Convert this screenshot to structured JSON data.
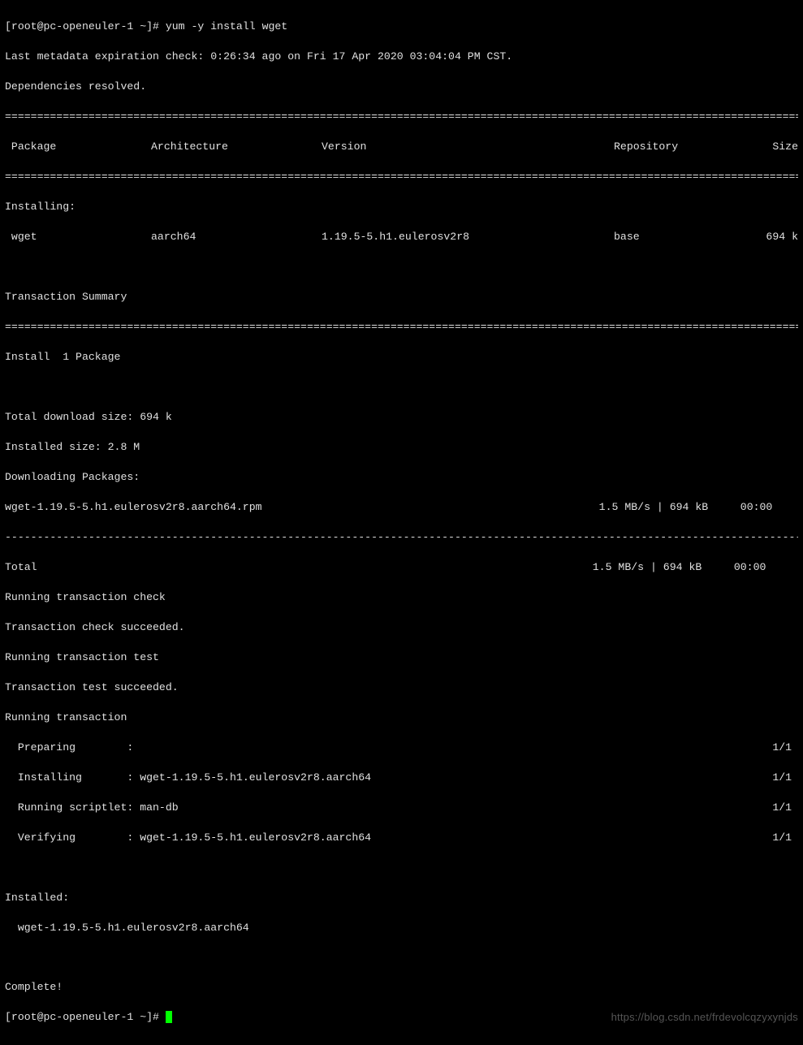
{
  "prompt1": "[root@pc-openeuler-1 ~]# ",
  "command": "yum -y install wget",
  "meta_line": "Last metadata expiration check: 0:26:34 ago on Fri 17 Apr 2020 03:04:04 PM CST.",
  "deps_line": "Dependencies resolved.",
  "hr_eq": "=================================================================================================================================",
  "hr_dash": "---------------------------------------------------------------------------------------------------------------------------------",
  "headers": {
    "package": " Package",
    "arch": "Architecture",
    "version": "Version",
    "repo": "Repository",
    "size": "Size"
  },
  "installing_label": "Installing:",
  "pkg": {
    "name": " wget",
    "arch": "aarch64",
    "version": "1.19.5-5.h1.eulerosv2r8",
    "repo": "base",
    "size": "694 k"
  },
  "txn_summary": "Transaction Summary",
  "install_count": "Install  1 Package",
  "total_download": "Total download size: 694 k",
  "installed_size": "Installed size: 2.8 M",
  "downloading": "Downloading Packages:",
  "dl_row": {
    "file": "wget-1.19.5-5.h1.eulerosv2r8.aarch64.rpm",
    "speed": "1.5 MB/s | 694 kB     00:00    "
  },
  "total_row": {
    "label": "Total",
    "speed": "1.5 MB/s | 694 kB     00:00     "
  },
  "steps": {
    "check": "Running transaction check",
    "check_ok": "Transaction check succeeded.",
    "test": "Running transaction test",
    "test_ok": "Transaction test succeeded.",
    "run": "Running transaction"
  },
  "trans": {
    "preparing": {
      "label": "  Preparing        :",
      "name": " ",
      "count": "1/1 "
    },
    "installing": {
      "label": "  Installing       :",
      "name": " wget-1.19.5-5.h1.eulerosv2r8.aarch64",
      "count": "1/1 "
    },
    "scriptlet": {
      "label": "  Running scriptlet:",
      "name": " man-db",
      "count": "1/1 "
    },
    "verifying": {
      "label": "  Verifying        :",
      "name": " wget-1.19.5-5.h1.eulerosv2r8.aarch64",
      "count": "1/1 "
    }
  },
  "installed_header": "Installed:",
  "installed_pkg": "  wget-1.19.5-5.h1.eulerosv2r8.aarch64",
  "complete": "Complete!",
  "prompt2": "[root@pc-openeuler-1 ~]# ",
  "watermark": "https://blog.csdn.net/frdevolcqzyxynjds"
}
